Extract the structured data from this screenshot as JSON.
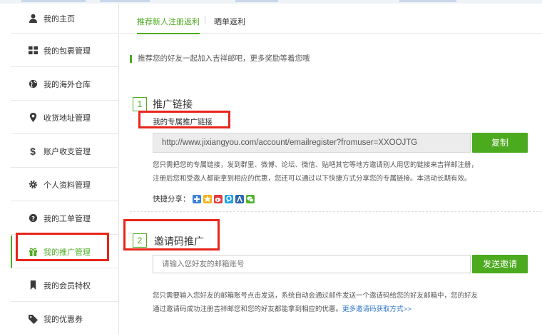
{
  "sidebar": {
    "items": [
      {
        "label": "我的主页",
        "icon": "user-icon"
      },
      {
        "label": "我的包裹管理",
        "icon": "grid-icon"
      },
      {
        "label": "我的海外仓库",
        "icon": "globe-icon"
      },
      {
        "label": "收货地址管理",
        "icon": "map-pin-icon"
      },
      {
        "label": "账户收支管理",
        "icon": "dollar-icon"
      },
      {
        "label": "个人资料管理",
        "icon": "gear-icon"
      },
      {
        "label": "我的工单管理",
        "icon": "question-icon"
      },
      {
        "label": "我的推广管理",
        "icon": "gift-icon"
      },
      {
        "label": "我的会员特权",
        "icon": "bookmark-icon"
      },
      {
        "label": "我的优惠券",
        "icon": "tag-icon"
      }
    ],
    "active_index": 7
  },
  "tabs": [
    {
      "label": "推荐新人注册返利",
      "active": true
    },
    {
      "label": "晒单返利",
      "active": false
    }
  ],
  "intro": "推荐您的好友一起加入吉祥邮吧，更多奖励等着您哦",
  "section1": {
    "number": "1",
    "title": "推广链接",
    "sub_label": "我的专属推广链接",
    "link": "http://www.jixiangyou.com/account/emailregister?fromuser=XXOOJTG",
    "copy_button": "复制",
    "desc_line1": "您只需把您的专属链接，发到群里、微博、论坛、微信、贴吧其它等地方邀请别人用您的链接来吉祥邮注册，",
    "desc_line2": "注册后您和受邀人都能拿到相应的优惠，您还可以通过以下快捷方式分享您的专属链接。本活动长期有效。",
    "share_label": "快捷分享："
  },
  "section2": {
    "number": "2",
    "title": "邀请码推广",
    "email_placeholder": "请输入您好友的邮箱账号",
    "send_button": "发送邀请",
    "desc_line1": "您只需要输入您好友的邮箱账号点击发送，系统自动会通过邮件发送一个邀请码给您的好友邮箱中，您的好友",
    "desc_line2": "通过邀请码成功注册吉祥邮您和您的好友都能拿到相应的优惠。",
    "more_link": "更多邀请码获取方式>>"
  },
  "colors": {
    "accent": "#4caa1f",
    "highlight_box": "#e8251b",
    "link": "#2b73c9"
  }
}
